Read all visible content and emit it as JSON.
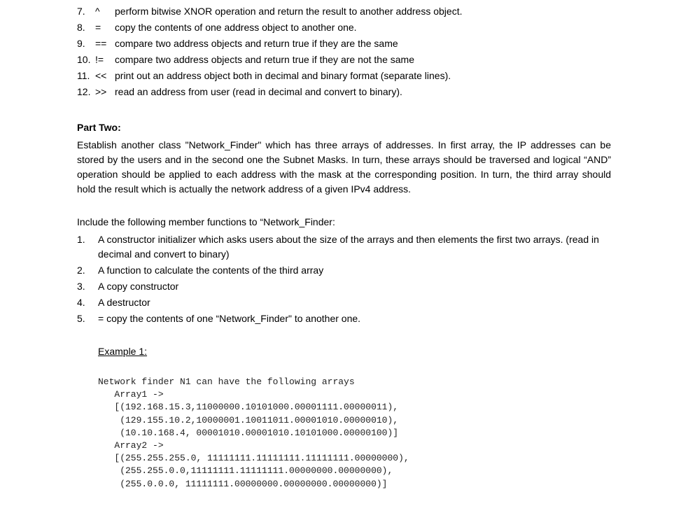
{
  "part_one_cont": [
    {
      "num": "7.",
      "op": "^",
      "desc": "perform bitwise XNOR operation and return the result to another address object."
    },
    {
      "num": "8.",
      "op": "=",
      "desc": "copy the contents of one address object to another one."
    },
    {
      "num": "9.",
      "op": "==",
      "desc": "compare two address objects and return true if they are the same"
    },
    {
      "num": "10.",
      "op": "!=",
      "desc": "compare two address objects and return true if they are not the same"
    },
    {
      "num": "11.",
      "op": "<<",
      "desc": "print out an address object both in decimal and binary format (separate lines)."
    },
    {
      "num": "12.",
      "op": ">>",
      "desc": "read an address from user (read in decimal and convert to binary)."
    }
  ],
  "part_two_heading": "Part Two:",
  "part_two_para": "Establish another class \"Network_Finder\" which has three arrays of addresses. In first array, the IP addresses can be stored by the users and in the second one the Subnet Masks. In turn, these arrays should be traversed and logical “AND” operation should be applied to each address with the mask at the corresponding position. In turn, the third array should hold the result which is actually the network address of a given IPv4 address.",
  "members_intro": "Include the following member functions to “Network_Finder:",
  "members": [
    {
      "num": "1.",
      "desc": "A constructor initializer which asks users about the size of the arrays and then elements the first two arrays. (read in decimal and convert to binary)"
    },
    {
      "num": "2.",
      "desc": "A function to calculate the contents of the third array"
    },
    {
      "num": "3.",
      "desc": "A copy constructor"
    },
    {
      "num": "4.",
      "desc": "A destructor"
    },
    {
      "num": "5.",
      "desc": "= copy the contents of one “Network_Finder\" to another one."
    }
  ],
  "example_heading": "Example 1:",
  "example_code": "Network finder N1 can have the following arrays\n   Array1 ->\n   [(192.168.15.3,11000000.10101000.00001111.00000011),\n    (129.155.10.2,10000001.10011011.00001010.00000010),\n    (10.10.168.4, 00001010.00001010.10101000.00000100)]\n   Array2 ->\n   [(255.255.255.0, 11111111.11111111.11111111.00000000),\n    (255.255.0.0,11111111.11111111.00000000.00000000),\n    (255.0.0.0, 11111111.00000000.00000000.00000000)]"
}
